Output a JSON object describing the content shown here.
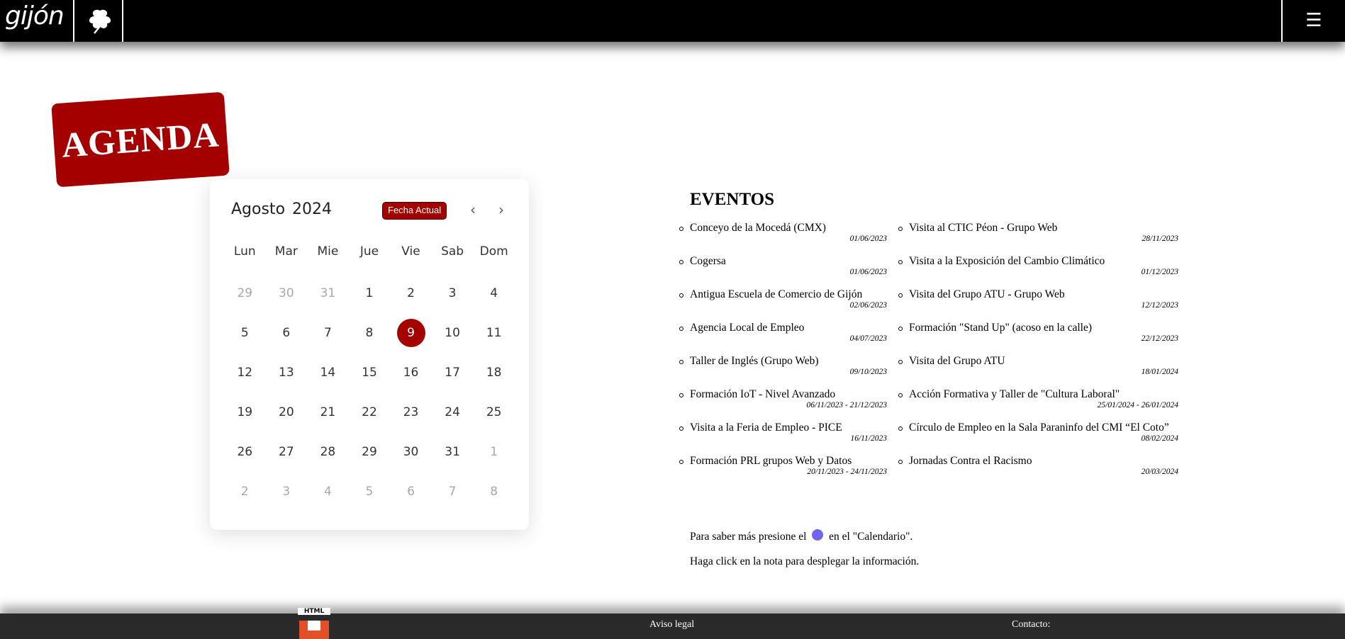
{
  "header": {
    "logo_text": "gijón",
    "menu_icon": "☰"
  },
  "agenda": {
    "label": "AGENDA"
  },
  "calendar": {
    "month": "Agosto",
    "year": "2024",
    "today_button": "Fecha Actual",
    "prev_icon": "‹",
    "next_icon": "›",
    "weekdays": [
      "Lun",
      "Mar",
      "Mie",
      "Jue",
      "Vie",
      "Sab",
      "Dom"
    ],
    "days": [
      {
        "n": "29",
        "muted": true
      },
      {
        "n": "30",
        "muted": true
      },
      {
        "n": "31",
        "muted": true
      },
      {
        "n": "1"
      },
      {
        "n": "2"
      },
      {
        "n": "3"
      },
      {
        "n": "4"
      },
      {
        "n": "5"
      },
      {
        "n": "6"
      },
      {
        "n": "7"
      },
      {
        "n": "8"
      },
      {
        "n": "9",
        "current": true
      },
      {
        "n": "10"
      },
      {
        "n": "11"
      },
      {
        "n": "12"
      },
      {
        "n": "13"
      },
      {
        "n": "14"
      },
      {
        "n": "15"
      },
      {
        "n": "16"
      },
      {
        "n": "17"
      },
      {
        "n": "18"
      },
      {
        "n": "19"
      },
      {
        "n": "20"
      },
      {
        "n": "21"
      },
      {
        "n": "22"
      },
      {
        "n": "23"
      },
      {
        "n": "24"
      },
      {
        "n": "25"
      },
      {
        "n": "26"
      },
      {
        "n": "27"
      },
      {
        "n": "28"
      },
      {
        "n": "29"
      },
      {
        "n": "30"
      },
      {
        "n": "31"
      },
      {
        "n": "1",
        "muted": true
      },
      {
        "n": "2",
        "muted": true
      },
      {
        "n": "3",
        "muted": true
      },
      {
        "n": "4",
        "muted": true
      },
      {
        "n": "5",
        "muted": true
      },
      {
        "n": "6",
        "muted": true
      },
      {
        "n": "7",
        "muted": true
      },
      {
        "n": "8",
        "muted": true
      }
    ]
  },
  "events": {
    "title": "EVENTOS",
    "column1": [
      {
        "name": "Conceyo de la Mocedá (CMX)",
        "date": "01/06/2023"
      },
      {
        "name": "Cogersa",
        "date": "01/06/2023"
      },
      {
        "name": "Antigua Escuela de Comercio de Gijón",
        "date": "02/06/2023"
      },
      {
        "name": "Agencia Local de Empleo",
        "date": "04/07/2023"
      },
      {
        "name": "Taller de Inglés (Grupo Web)",
        "date": "09/10/2023"
      },
      {
        "name": "Formación IoT - Nivel Avanzado",
        "date": "06/11/2023 - 21/12/2023"
      },
      {
        "name": "Visita a la Feria de Empleo - PICE",
        "date": "16/11/2023"
      },
      {
        "name": "Formación PRL grupos Web y Datos",
        "date": "20/11/2023 - 24/11/2023"
      }
    ],
    "column2": [
      {
        "name": "Visita al CTIC Péon - Grupo Web",
        "date": "28/11/2023"
      },
      {
        "name": "Visita a la Exposición del Cambio Climático",
        "date": "01/12/2023"
      },
      {
        "name": "Visita del Grupo ATU - Grupo Web",
        "date": "12/12/2023"
      },
      {
        "name": "Formación \"Stand Up\" (acoso en la calle)",
        "date": "22/12/2023"
      },
      {
        "name": "Visita del Grupo ATU",
        "date": "18/01/2024"
      },
      {
        "name": "Acción Formativa y Taller de \"Cultura Laboral\"",
        "date": "25/01/2024 - 26/01/2024"
      },
      {
        "name": "Círculo de Empleo en la Sala Paraninfo del CMI “El Coto”",
        "date": "08/02/2024"
      },
      {
        "name": "Jornadas Contra el Racismo",
        "date": "20/03/2024"
      }
    ],
    "note1_before": "Para saber más presione el",
    "note1_after": "en el \"Calendario\".",
    "note2": "Haga click en la nota para desplegar la información."
  },
  "colors": {
    "accent_red": "#a50000",
    "info_dot": "#7065f0"
  },
  "footer": {
    "html5_label": "HTML",
    "link1": "Aviso legal",
    "link2": "Contacto:"
  }
}
